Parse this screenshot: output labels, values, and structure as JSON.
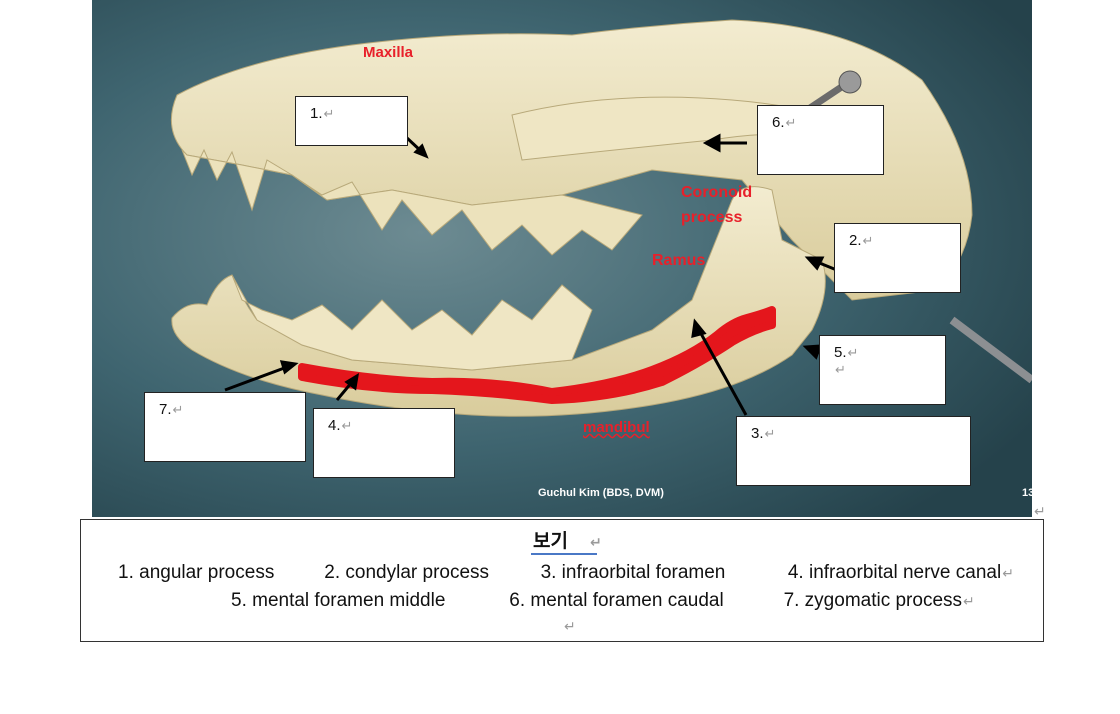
{
  "labels": {
    "maxilla": "Maxilla",
    "coronoid": "Coronoid process",
    "coronoid_line1": "Coronoid",
    "coronoid_line2": "process",
    "ramus": "Ramus",
    "mandibul": "mandibul",
    "credit": "Guchul Kim (BDS, DVM)",
    "page_num": "13"
  },
  "boxes": [
    {
      "num": "1."
    },
    {
      "num": "2."
    },
    {
      "num": "3."
    },
    {
      "num": "4."
    },
    {
      "num": "5."
    },
    {
      "num": "6."
    },
    {
      "num": "7."
    }
  ],
  "paragraph_mark": "↵",
  "legend": {
    "title": "보기",
    "row1": [
      "1. angular process",
      "2. condylar process",
      "3. infraorbital foramen",
      "4. infraorbital nerve canal"
    ],
    "row2": [
      "5. mental foramen middle",
      "6. mental foramen caudal",
      "7. zygomatic process"
    ]
  },
  "colors": {
    "background_teal": "#3f6570",
    "bone": "#e9dfb8",
    "annotation_red": "#e8202a",
    "marker_red": "#e4161c"
  }
}
